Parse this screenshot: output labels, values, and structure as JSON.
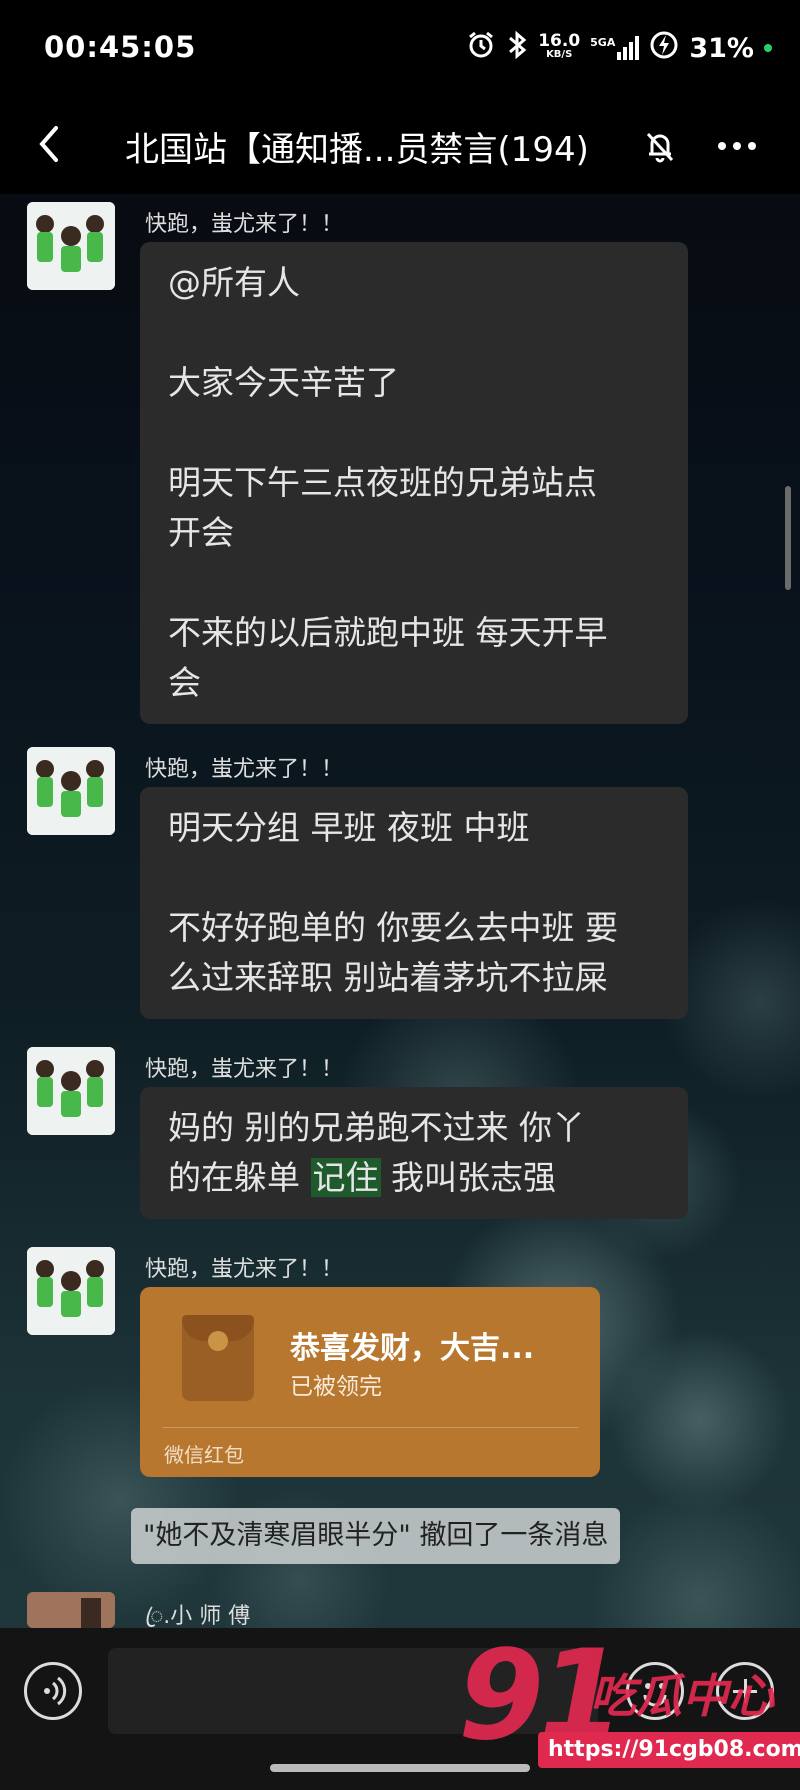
{
  "status_bar": {
    "time": "00:45:05",
    "net_speed_value": "16.0",
    "net_speed_unit": "KB/S",
    "signal_label": "5GA",
    "battery": "31%"
  },
  "header": {
    "title": "北国站【通知播...员禁言(194)"
  },
  "messages": [
    {
      "nickname": "快跑，蚩尤来了！！",
      "lines": [
        "@所有人",
        "大家今天辛苦了",
        "明天下午三点夜班的兄弟站点",
        "开会",
        "不来的以后就跑中班 每天开早",
        "会"
      ]
    },
    {
      "nickname": "快跑，蚩尤来了！！",
      "lines": [
        "明天分组 早班 夜班 中班",
        "不好好跑单的 你要么去中班 要",
        "么过来辞职 别站着茅坑不拉屎"
      ]
    },
    {
      "nickname": "快跑，蚩尤来了！！",
      "line1": "妈的 别的兄弟跑不过来  你丫",
      "line2_before": "的在躲单 ",
      "line2_highlight": "记住",
      "line2_after": " 我叫张志强"
    },
    {
      "nickname": "快跑，蚩尤来了！！",
      "red_packet": {
        "title": "恭喜发财，大吉...",
        "status": "已被领完",
        "label": "微信红包"
      }
    }
  ],
  "system_note": "\"她不及清寒眉眼半分\" 撤回了一条消息",
  "last_sender": "ꦿ.小 师 傅",
  "input": {
    "placeholder": ""
  },
  "watermark": {
    "number": "91",
    "text": "吃瓜中心",
    "url": "https://91cgb08.com"
  }
}
